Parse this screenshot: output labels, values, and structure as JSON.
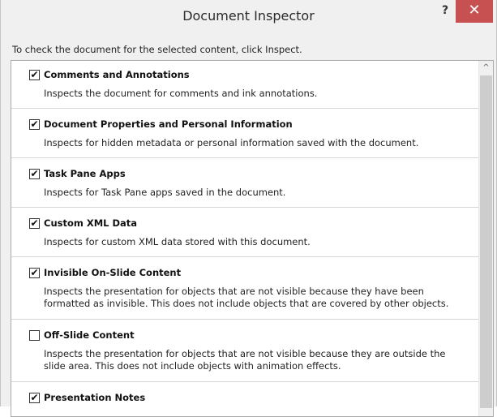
{
  "window": {
    "title": "Document Inspector",
    "help_label": "?",
    "close_label": "✕"
  },
  "instruction": "To check the document for the selected content, click Inspect.",
  "items": [
    {
      "title": "Comments and Annotations",
      "description": "Inspects the document for comments and ink annotations.",
      "checked": true
    },
    {
      "title": "Document Properties and Personal Information",
      "description": "Inspects for hidden metadata or personal information saved with the document.",
      "checked": true
    },
    {
      "title": "Task Pane Apps",
      "description": "Inspects for Task Pane apps saved in the document.",
      "checked": true
    },
    {
      "title": "Custom XML Data",
      "description": "Inspects for custom XML data stored with this document.",
      "checked": true
    },
    {
      "title": "Invisible On-Slide Content",
      "description": "Inspects the presentation for objects that are not visible because they have been formatted as invisible. This does not include objects that are covered by other objects.",
      "checked": true
    },
    {
      "title": "Off-Slide Content",
      "description": "Inspects the presentation for objects that are not visible because they are outside the slide area.  This does not include objects with animation effects.",
      "checked": false
    },
    {
      "title": "Presentation Notes",
      "description": "",
      "checked": true
    }
  ],
  "scrollbar": {
    "up_arrow": "^"
  },
  "colors": {
    "close_button": "#c75050",
    "window_bg": "#f0f0f0",
    "list_bg": "#ffffff"
  }
}
